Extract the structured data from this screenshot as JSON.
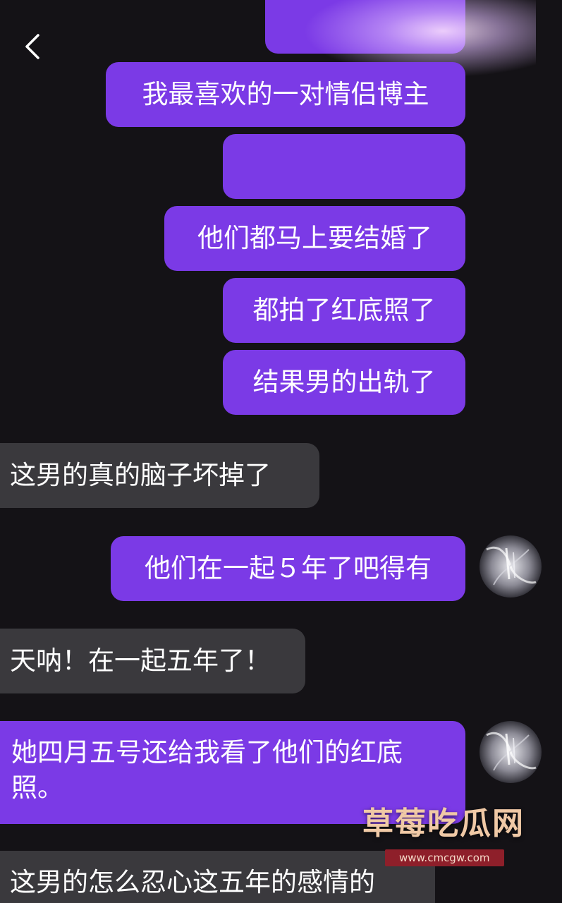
{
  "header": {
    "back_icon": "chevron-left-icon"
  },
  "messages": [
    {
      "side": "out",
      "text": ""
    },
    {
      "side": "out",
      "text": "我最喜欢的一对情侣博主"
    },
    {
      "side": "out",
      "text": ""
    },
    {
      "side": "out",
      "text": "他们都马上要结婚了"
    },
    {
      "side": "out",
      "text": "都拍了红底照了"
    },
    {
      "side": "out",
      "text": "结果男的出轨了"
    },
    {
      "side": "in",
      "text": "这男的真的脑子坏掉了"
    },
    {
      "side": "out",
      "text": "他们在一起５年了吧得有"
    },
    {
      "side": "in",
      "text": "天呐！在一起五年了！"
    },
    {
      "side": "out",
      "text": "她四月五号还给我看了他们的红底照。"
    },
    {
      "side": "in",
      "text": "这男的怎么忍心这五年的感情的"
    }
  ],
  "watermark": {
    "title": "草莓吃瓜网",
    "url": "www.cmcgw.com"
  },
  "colors": {
    "background": "#141216",
    "outgoing_bubble": "#7b3ae6",
    "incoming_bubble": "#3a393d"
  }
}
